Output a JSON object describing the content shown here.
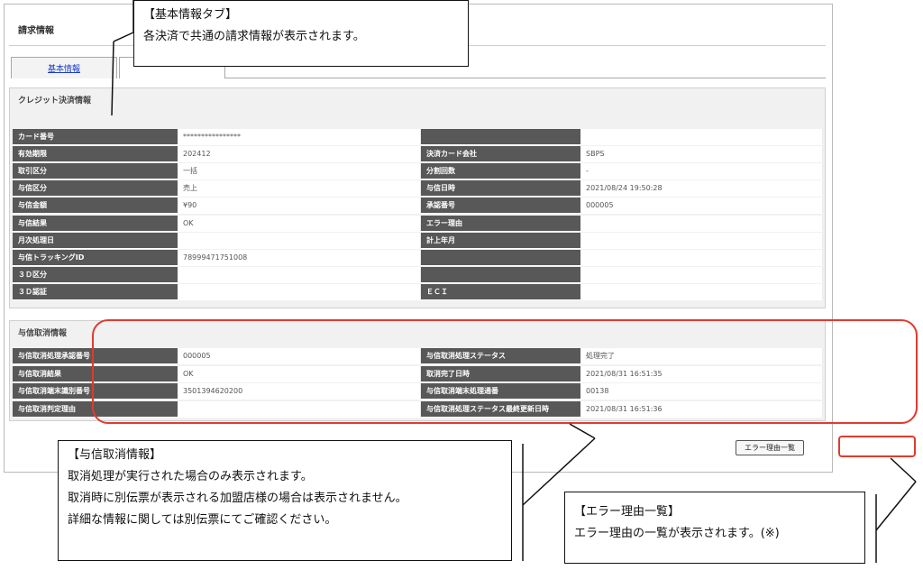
{
  "page_title": "請求情報",
  "tabs": [
    {
      "label": "基本情報"
    },
    {
      "label": ""
    }
  ],
  "credit_section": {
    "title": "クレジット決済情報",
    "rows": [
      [
        "カード番号",
        "****************",
        "",
        ""
      ],
      [
        "有効期限",
        "202412",
        "決済カード会社",
        "SBPS"
      ],
      [
        "取引区分",
        "一括",
        "分割回数",
        "-"
      ],
      [
        "与信区分",
        "売上",
        "与信日時",
        "2021/08/24 19:50:28"
      ],
      [
        "与信金額",
        "¥90",
        "承認番号",
        "000005"
      ],
      [
        "与信結果",
        "OK",
        "エラー理由",
        ""
      ],
      [
        "月次処理日",
        "",
        "計上年月",
        ""
      ],
      [
        "与信トラッキングID",
        "78999471751008",
        "",
        ""
      ],
      [
        "３Ｄ区分",
        "",
        "",
        ""
      ],
      [
        "３Ｄ認証",
        "",
        "ＥＣＩ",
        ""
      ]
    ]
  },
  "void_section": {
    "title": "与信取消情報",
    "rows": [
      [
        "与信取消処理承認番号",
        "000005",
        "与信取消処理ステータス",
        "処理完了"
      ],
      [
        "与信取消結果",
        "OK",
        "取消完了日時",
        "2021/08/31 16:51:35"
      ],
      [
        "与信取消端末識別番号",
        "3501394620200",
        "与信取消端末処理通番",
        "00138"
      ],
      [
        "与信取消判定理由",
        "",
        "与信取消処理ステータス最終更新日時",
        "2021/08/31 16:51:36"
      ]
    ]
  },
  "error_button_label": "エラー理由一覧",
  "callouts": {
    "basic": {
      "title": "【基本情報タブ】",
      "lines": [
        "各決済で共通の請求情報が表示されます。"
      ]
    },
    "void": {
      "title": "【与信取消情報】",
      "lines": [
        "取消処理が実行された場合のみ表示されます。",
        "取消時に別伝票が表示される加盟店様の場合は表示されません。",
        "詳細な情報に関しては別伝票にてご確認ください。"
      ]
    },
    "error": {
      "title": "【エラー理由一覧】",
      "lines": [
        "エラー理由の一覧が表示されます。(※)"
      ]
    }
  },
  "colors": {
    "header_cell": "#585858",
    "highlight": "#e03b2d",
    "link": "#1a3cc8"
  }
}
